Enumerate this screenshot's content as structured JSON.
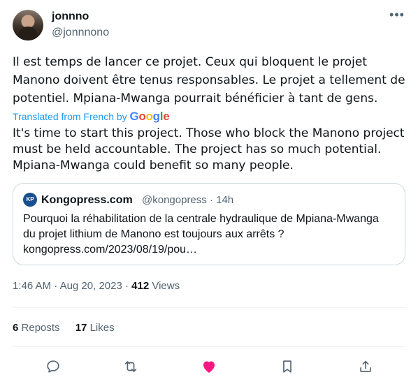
{
  "author": {
    "display_name": "jonnno",
    "handle": "@jonnnono"
  },
  "menu_icon": "more-dots-icon",
  "tweet": {
    "text": "Il est temps de lancer ce projet. Ceux qui bloquent le projet Manono doivent être tenus responsables. Le projet a tellement de potentiel. Mpiana-Mwanga pourrait bénéficier à tant de gens.",
    "translated_label": "Translated from French by",
    "translator_brand": [
      "G",
      "o",
      "o",
      "g",
      "l",
      "e"
    ],
    "translation": "It's time to start this project. Those who block the Manono project must be held accountable. The project has so much potential. Mpiana-Mwanga could benefit so many people."
  },
  "quote": {
    "avatar_label": "KP",
    "name": "Kongopress.com",
    "handle_time": "@kongopress · 14h",
    "text": "Pourquoi la réhabilitation de la centrale hydraulique de Mpiana-Mwanga du projet lithium de Manono est toujours aux arrêts ? kongopress.com/2023/08/19/pou…"
  },
  "meta": {
    "time": "1:46 AM",
    "date": "Aug 20, 2023",
    "views_count": "412",
    "views_label": "Views",
    "separator": "·"
  },
  "stats": {
    "reposts_count": "6",
    "reposts_label": "Reposts",
    "likes_count": "17",
    "likes_label": "Likes"
  },
  "actions": {
    "reply_icon": "reply-icon",
    "repost_icon": "repost-icon",
    "like_icon": "heart-icon",
    "bookmark_icon": "bookmark-icon",
    "share_icon": "share-icon",
    "like_color": "#f91880",
    "icon_color": "#536471"
  }
}
